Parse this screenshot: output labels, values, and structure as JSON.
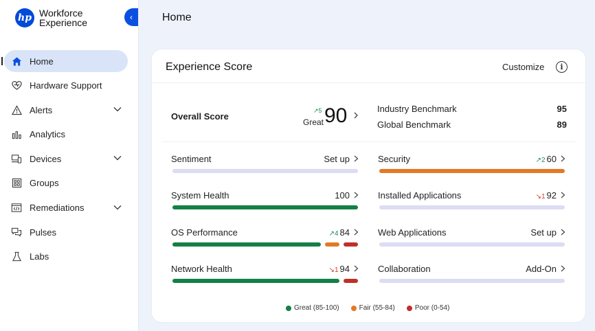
{
  "brand": {
    "line1": "Workforce",
    "line2": "Experience",
    "logo": "hp"
  },
  "sidebar": {
    "items": [
      {
        "label": "Home",
        "icon": "home-icon",
        "active": true
      },
      {
        "label": "Hardware Support",
        "icon": "heart-shield-icon"
      },
      {
        "label": "Alerts",
        "icon": "warning-icon",
        "expandable": true
      },
      {
        "label": "Analytics",
        "icon": "bar-chart-icon"
      },
      {
        "label": "Devices",
        "icon": "devices-icon",
        "expandable": true
      },
      {
        "label": "Groups",
        "icon": "grid-icon"
      },
      {
        "label": "Remediations",
        "icon": "code-window-icon",
        "expandable": true
      },
      {
        "label": "Pulses",
        "icon": "chat-icon"
      },
      {
        "label": "Labs",
        "icon": "flask-icon"
      }
    ]
  },
  "header": {
    "title": "Home"
  },
  "card": {
    "title": "Experience Score",
    "customize": "Customize",
    "overall": {
      "label": "Overall Score",
      "delta": "↗5",
      "rating": "Great",
      "value": "90"
    },
    "benchmarks": [
      {
        "label": "Industry Benchmark",
        "value": "95"
      },
      {
        "label": "Global Benchmark",
        "value": "89"
      }
    ],
    "metrics": [
      {
        "label": "Sentiment",
        "value": "Set up",
        "delta": ""
      },
      {
        "label": "Security",
        "value": "60",
        "delta": "↗2",
        "trend": "up"
      },
      {
        "label": "System Health",
        "value": "100",
        "delta": ""
      },
      {
        "label": "Installed Applications",
        "value": "92",
        "delta": "↘1",
        "trend": "down"
      },
      {
        "label": "OS Performance",
        "value": "84",
        "delta": "↗4",
        "trend": "up"
      },
      {
        "label": "Web Applications",
        "value": "Set up",
        "delta": ""
      },
      {
        "label": "Network Health",
        "value": "94",
        "delta": "↘1",
        "trend": "down"
      },
      {
        "label": "Collaboration",
        "value": "Add-On",
        "delta": ""
      }
    ],
    "legend": [
      {
        "label": "Great (85-100)",
        "color": "#138046"
      },
      {
        "label": "Fair (55-84)",
        "color": "#e07a2a"
      },
      {
        "label": "Poor (0-54)",
        "color": "#c0302a"
      }
    ]
  },
  "colors": {
    "great": "#138046",
    "fair": "#e07a2a",
    "poor": "#c0302a",
    "empty": "#dcdcf3",
    "accent": "#0b4fe0"
  }
}
